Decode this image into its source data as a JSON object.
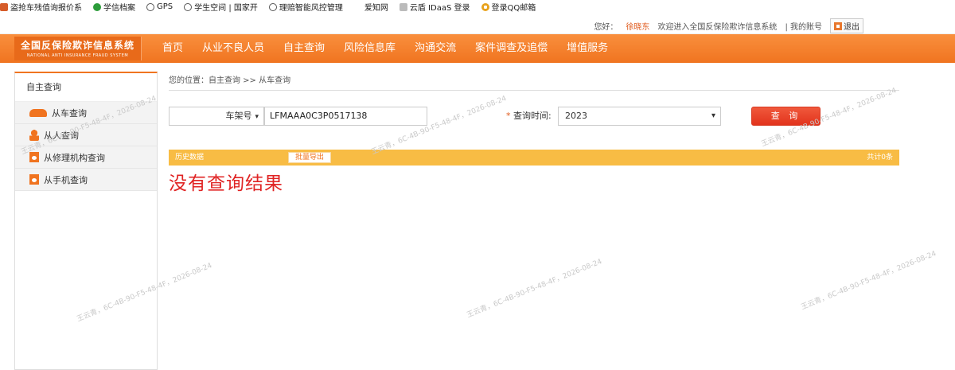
{
  "bookmarks": [
    {
      "label": "盗抢车残值询报价系",
      "color": "#d65c2a",
      "icon": "page-icon"
    },
    {
      "label": "学信档案",
      "color": "#2c9c3a",
      "icon": "leaf-icon"
    },
    {
      "label": "GPS",
      "color": "#555555",
      "icon": "globe-icon"
    },
    {
      "label": "学生空间 | 国家开",
      "color": "#555555",
      "icon": "globe-icon"
    },
    {
      "label": "理赔智能风控管理",
      "color": "#555555",
      "icon": "globe-icon"
    },
    {
      "label": "爱知网",
      "color": "#999999",
      "icon": "page-icon"
    },
    {
      "label": "云盾 IDaaS 登录",
      "color": "#bbbbbb",
      "icon": "page-icon"
    },
    {
      "label": "登录QQ邮箱",
      "color": "#e8a21c",
      "icon": "qq-icon"
    }
  ],
  "topbar": {
    "greeting": "您好：",
    "username": "徐晓东",
    "welcome": "欢迎进入全国反保险欺诈信息系统",
    "account": "| 我的账号",
    "exit": "退出"
  },
  "logo": {
    "cn": "全国反保险欺诈信息系统",
    "en": "NATIONAL ANTI INSURANCE FRAUD SYSTEM"
  },
  "menu": [
    "首页",
    "从业不良人员",
    "自主查询",
    "风险信息库",
    "沟通交流",
    "案件调查及追偿",
    "增值服务"
  ],
  "sidebar": {
    "title": "自主查询",
    "items": [
      {
        "label": "从车查询",
        "icon": "car-icon"
      },
      {
        "label": "从人查询",
        "icon": "person-icon"
      },
      {
        "label": "从修理机构查询",
        "icon": "document-icon"
      },
      {
        "label": "从手机查询",
        "icon": "document-icon"
      }
    ]
  },
  "breadcrumb": "您的位置：自主查询 >> 从车查询",
  "query": {
    "type_selected": "车架号",
    "vin_value": "LFMAAA0C3P0517138",
    "time_label": "查询时间:",
    "year_selected": "2023",
    "button": "查 询"
  },
  "results": {
    "label": "历史数据",
    "export": "批量导出",
    "total": "共计0条",
    "empty": "没有查询结果"
  },
  "watermark": "王云青，6C-4B-90-F5-48-4F，2026-08-24",
  "colors": {
    "accent": "#f07420",
    "bar": "#f8bc44",
    "danger": "#e02424"
  }
}
